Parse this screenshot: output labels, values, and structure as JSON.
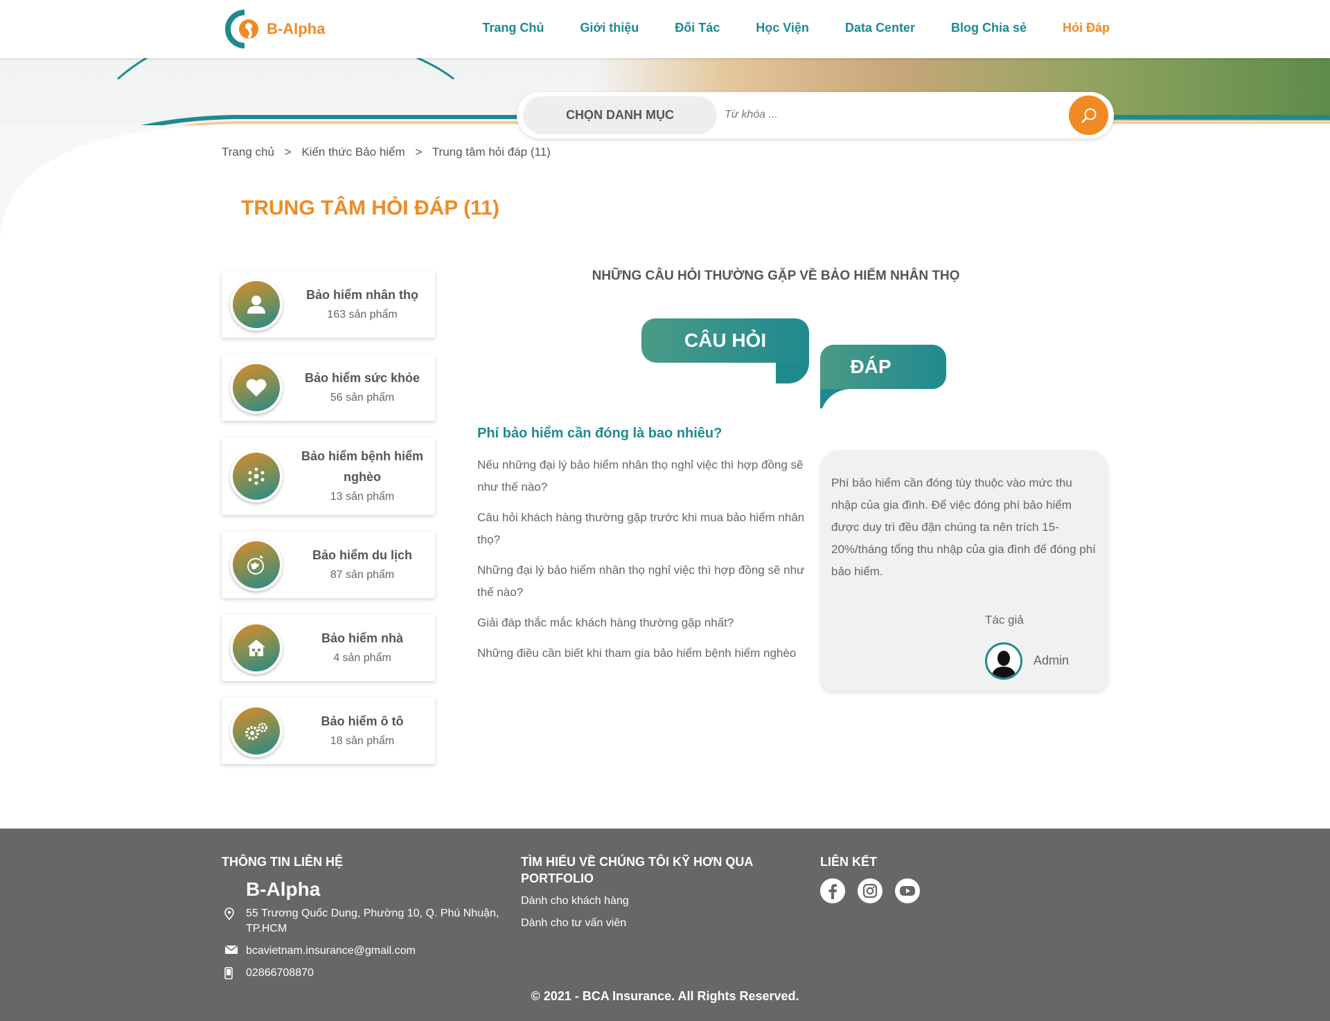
{
  "header": {
    "logo_text": "B-Alpha",
    "nav": [
      {
        "label": "Trang Chủ"
      },
      {
        "label": "Giới thiệu"
      },
      {
        "label": "Đối Tác"
      },
      {
        "label": "Học Viện"
      },
      {
        "label": "Data Center"
      },
      {
        "label": "Blog Chia sẻ"
      },
      {
        "label": "Hỏi Đáp",
        "active": true
      }
    ]
  },
  "search": {
    "category_label": "CHỌN DANH MỤC",
    "placeholder": "Từ khóa ..."
  },
  "breadcrumb": [
    "Trang chủ",
    "Kiến thức Bảo hiểm",
    "Trung tâm hỏi đáp (11)"
  ],
  "page_title": "TRUNG TÂM HỎI ĐÁP (11)",
  "categories": [
    {
      "name": "Bảo hiểm nhân thọ",
      "count": "163 sản phẩm",
      "icon": "person-icon"
    },
    {
      "name": "Bảo hiểm sức khỏe",
      "count": "56 sản phẩm",
      "icon": "heart-icon"
    },
    {
      "name": "Bảo hiểm bệnh hiểm nghèo",
      "count": "13 sản phẩm",
      "icon": "molecule-icon"
    },
    {
      "name": "Bảo hiểm du lịch",
      "count": "87 sản phẩm",
      "icon": "globe-plane-icon"
    },
    {
      "name": "Bảo hiểm nhà",
      "count": "4 sản phẩm",
      "icon": "house-icon"
    },
    {
      "name": "Bảo hiểm ô tô",
      "count": "18 sản phẩm",
      "icon": "gears-icon"
    }
  ],
  "main": {
    "section_title": "NHỮNG CÂU HỎI THƯỜNG GẶP VỀ BẢO HIỂM NHÂN THỌ",
    "tab_question": "CÂU HỎI",
    "tab_answer": "ĐÁP",
    "active_question": "Phí bảo hiểm cần đóng là bao nhiêu?",
    "questions": [
      "Nếu những đại lý bảo hiểm nhân thọ nghỉ việc thì hợp đồng sẽ như thế nào?",
      "Câu hỏi khách hàng thường gặp trước khi mua bảo hiểm nhân thọ?",
      "Những đại lý bảo hiểm nhân thọ nghỉ việc thì hợp đồng sẽ như thế nào?",
      "Giải đáp thắc mắc khách hàng thường gặp nhất?",
      "Những điều cần biết khi tham gia bảo hiểm bệnh hiểm nghèo"
    ],
    "answer": "Phí bảo hiểm cần đóng tùy thuộc vào mức thu nhập của gia đình. Để việc đóng phí bảo hiểm được duy trì đều đặn chúng ta nên trích 15-20%/tháng tổng thu nhập của gia đình để đóng phí bảo hiểm.",
    "author_label": "Tác giả",
    "author_name": "Admin"
  },
  "footer": {
    "contact_heading": "THÔNG TIN LIÊN HỆ",
    "brand": "B-Alpha",
    "address": "55 Trương Quốc Dung, Phường 10, Q. Phú Nhuận, TP.HCM",
    "email": "bcavietnam.insurance@gmail.com",
    "phone": "02866708870",
    "portfolio_heading": "TÌM HIỂU VỀ CHÚNG TÔI KỸ HƠN QUA PORTFOLIO",
    "portfolio_links": [
      "Dành cho khách hàng",
      "Dành cho tư vấn viên"
    ],
    "links_heading": "LIÊN KẾT",
    "copyright": "© 2021 - BCA Insurance. All Rights Reserved."
  },
  "colors": {
    "accent_orange": "#f08a24",
    "teal": "#1f8a8e",
    "footer_bg": "#676767"
  }
}
